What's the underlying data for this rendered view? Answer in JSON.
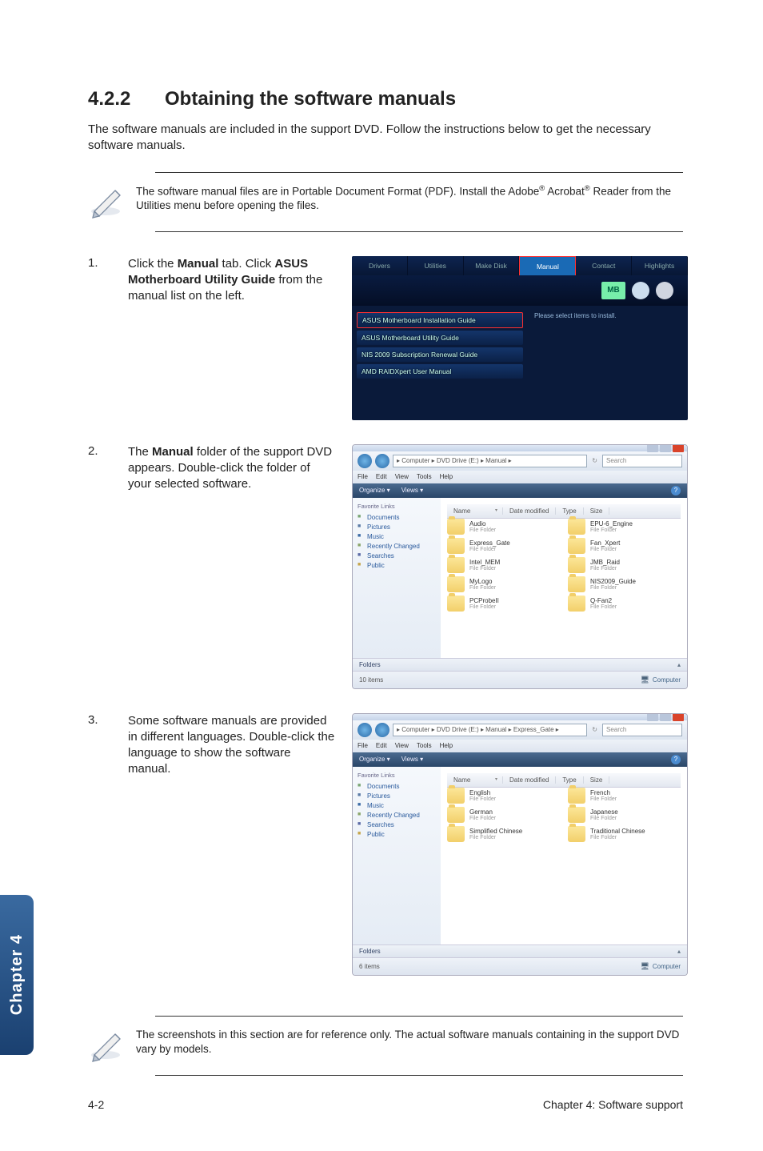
{
  "section": {
    "number": "4.2.2",
    "title": "Obtaining the software manuals"
  },
  "intro": "The software manuals are included in the support DVD. Follow the instructions below to get the necessary software manuals.",
  "note1": {
    "part1": "The software manual files are in Portable Document Format (PDF). Install the Adobe",
    "part2": " Acrobat",
    "part3": " Reader from the Utilities menu before opening the files."
  },
  "steps": {
    "s1": {
      "num": "1.",
      "before": "Click the ",
      "b1": "Manual",
      "mid1": " tab. Click ",
      "b2": "ASUS Motherboard Utility Guide",
      "after": " from the manual list on the left."
    },
    "s2": {
      "num": "2.",
      "before": "The ",
      "b1": "Manual",
      "after": " folder of the support DVD appears. Double-click the folder of your selected software."
    },
    "s3": {
      "num": "3.",
      "text": "Some software manuals are provided in different languages. Double-click the language to show the software manual."
    }
  },
  "shot1": {
    "tabs": [
      "Drivers",
      "Utilities",
      "Make Disk",
      "Manual",
      "Contact",
      "Highlights"
    ],
    "mb": "MB",
    "right_hint": "Please select items to install.",
    "items": [
      "ASUS Motherboard Installation Guide",
      "ASUS Motherboard Utility Guide",
      "NIS 2009 Subscription Renewal Guide",
      "AMD RAIDXpert User Manual"
    ]
  },
  "explorer": {
    "menus": [
      "File",
      "Edit",
      "View",
      "Tools",
      "Help"
    ],
    "orgbar": [
      "Organize ▾",
      "Views ▾"
    ],
    "fav_header": "Favorite Links",
    "side": [
      "Documents",
      "Pictures",
      "Music",
      "Recently Changed",
      "Searches",
      "Public"
    ],
    "side_classes": [
      "doc",
      "pic",
      "mus",
      "rec",
      "sea",
      "pub"
    ],
    "cols": [
      "Name",
      "Date modified",
      "Type",
      "Size"
    ],
    "folders_label": "Folders",
    "search_placeholder": "Search",
    "refresh": "↻",
    "path_arrow": "▸",
    "path_sep": "▸",
    "bullet": "▾"
  },
  "shot2": {
    "path": "▸  Computer  ▸  DVD Drive (E:)  ▸  Manual  ▸",
    "files": [
      {
        "n": "Audio",
        "t": "File Folder"
      },
      {
        "n": "EPU-6_Engine",
        "t": "File Folder"
      },
      {
        "n": "Express_Gate",
        "t": "File Folder"
      },
      {
        "n": "Fan_Xpert",
        "t": "File Folder"
      },
      {
        "n": "Intel_MEM",
        "t": "File Folder"
      },
      {
        "n": "JMB_Raid",
        "t": "File Folder"
      },
      {
        "n": "MyLogo",
        "t": "File Folder"
      },
      {
        "n": "NIS2009_Guide",
        "t": "File Folder"
      },
      {
        "n": "PCProbeII",
        "t": "File Folder"
      },
      {
        "n": "Q-Fan2",
        "t": "File Folder"
      }
    ],
    "status_left": "10 items",
    "status_right": "Computer"
  },
  "shot3": {
    "path": "▸  Computer  ▸  DVD Drive (E:)  ▸  Manual  ▸  Express_Gate  ▸",
    "files": [
      {
        "n": "English",
        "t": "File Folder"
      },
      {
        "n": "French",
        "t": "File Folder"
      },
      {
        "n": "German",
        "t": "File Folder"
      },
      {
        "n": "Japanese",
        "t": "File Folder"
      },
      {
        "n": "Simplified Chinese",
        "t": "File Folder"
      },
      {
        "n": "Traditional Chinese",
        "t": "File Folder"
      }
    ],
    "status_left": "6 items",
    "status_right": "Computer"
  },
  "note2": "The screenshots in this section are for reference only. The actual software manuals containing in the support DVD vary by models.",
  "side_tab": "Chapter 4",
  "footer": {
    "left": "4-2",
    "right": "Chapter 4: Software support"
  }
}
